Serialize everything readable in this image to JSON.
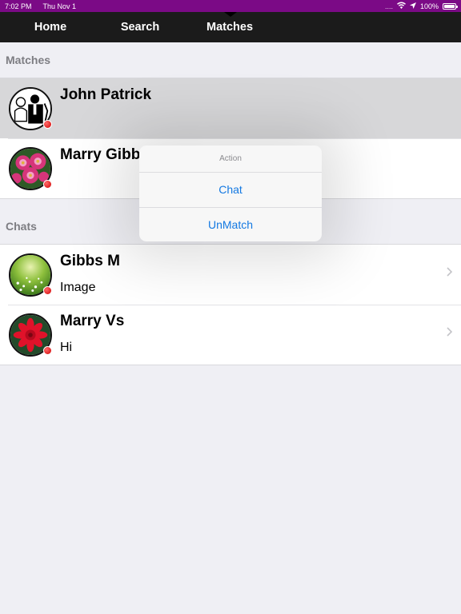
{
  "status_bar": {
    "time": "7:02 PM",
    "date": "Thu Nov 1",
    "signal": "....",
    "battery": "100%",
    "battery_level": 1.0
  },
  "nav": {
    "tabs": [
      {
        "label": "Home"
      },
      {
        "label": "Search"
      },
      {
        "label": "Matches"
      }
    ],
    "selected": "Matches"
  },
  "matches": {
    "header": "Matches",
    "items": [
      {
        "name": "John Patrick",
        "avatar": "couple-illustration",
        "status": "offline"
      },
      {
        "name": "Marry Gibb",
        "avatar": "pink-flowers",
        "status": "offline"
      }
    ]
  },
  "chats": {
    "header": "Chats",
    "items": [
      {
        "name": "Gibbs M",
        "last_message": "Image",
        "avatar": "green-meadow",
        "status": "offline"
      },
      {
        "name": "Marry Vs",
        "last_message": "Hi",
        "avatar": "red-dahlia",
        "status": "offline"
      }
    ]
  },
  "action_sheet": {
    "title": "Action",
    "buttons": [
      "Chat",
      "UnMatch"
    ]
  },
  "colors": {
    "status_bar": "#7b0a86",
    "nav_bar": "#1b1b1b",
    "background": "#efeff4",
    "accent": "#1479e2",
    "status_dot": "#d10000"
  }
}
